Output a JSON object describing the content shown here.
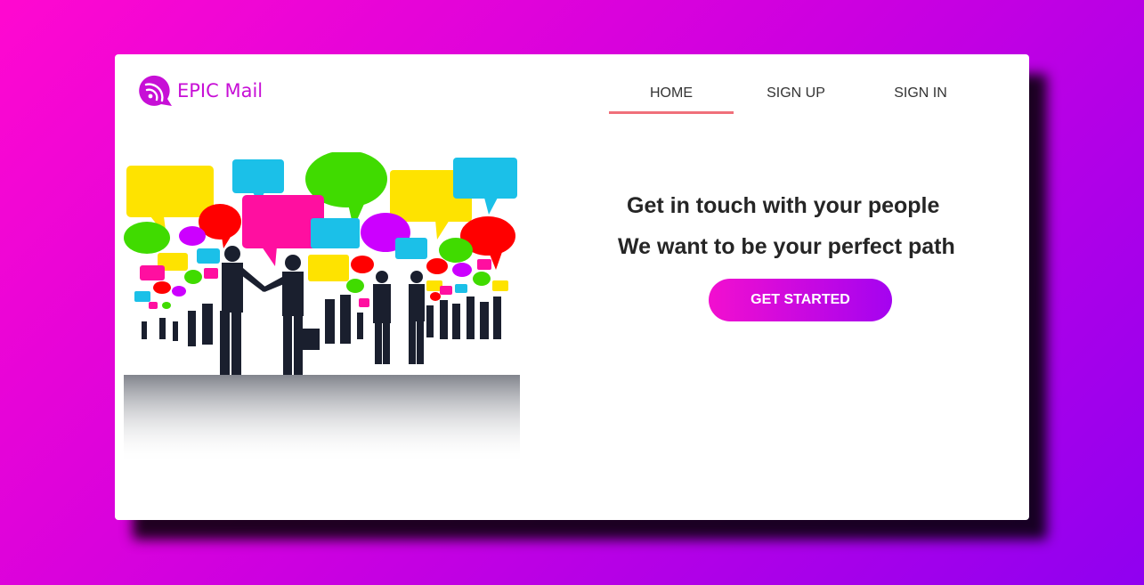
{
  "brand": {
    "name": "EPIC Mail",
    "color": "#c70fd6",
    "logo_icon": "wifi-speech-bubble-icon"
  },
  "nav": {
    "items": [
      {
        "label": "HOME",
        "active": true
      },
      {
        "label": "SIGN UP",
        "active": false
      },
      {
        "label": "SIGN IN",
        "active": false
      }
    ],
    "active_indicator_color": "#f0707a"
  },
  "hero": {
    "headline": "Get in touch with your people",
    "subheadline": "We want to be your perfect path",
    "cta_label": "GET STARTED",
    "image_icon": "people-networking-speech-bubbles-illustration"
  },
  "colors": {
    "background_gradient": [
      "#ff08d0",
      "#9000f0"
    ],
    "cta_gradient": [
      "#f20fcf",
      "#a403f0"
    ]
  }
}
